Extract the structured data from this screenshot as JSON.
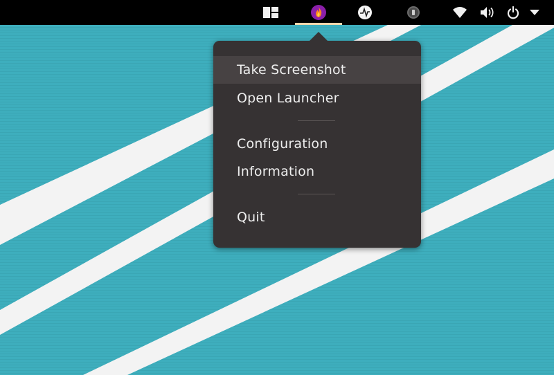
{
  "top_panel": {
    "tray_icons": [
      {
        "name": "window-tiling-icon"
      },
      {
        "name": "flameshot-icon",
        "color": "#8b1fa9",
        "active": true
      },
      {
        "name": "clock-app-icon"
      },
      {
        "name": "keyring-icon"
      },
      {
        "name": "wifi-icon"
      },
      {
        "name": "volume-icon"
      },
      {
        "name": "power-icon"
      },
      {
        "name": "chevron-down-icon"
      }
    ],
    "active_underline_color": "#f3d8ad"
  },
  "desktop": {
    "wallpaper_color": "#3eaebd",
    "stripe_color": "#f3f3f3"
  },
  "menu": {
    "items": [
      {
        "label": "Take Screenshot",
        "highlighted": true
      },
      {
        "label": "Open Launcher"
      },
      {
        "label": "Configuration"
      },
      {
        "label": "Information"
      },
      {
        "label": "Quit"
      }
    ],
    "background": "#363233",
    "hover_background": "#474243"
  }
}
